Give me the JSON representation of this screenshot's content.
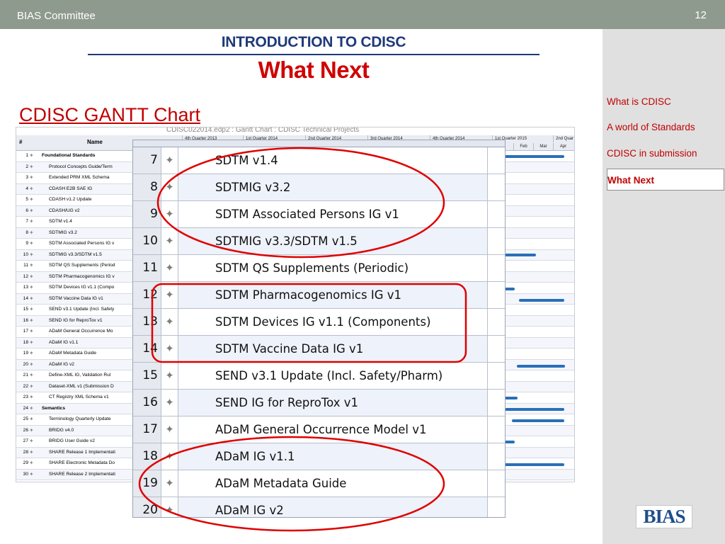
{
  "header": {
    "org": "BIAS Committee",
    "page_number": "12"
  },
  "slide": {
    "section_title": "INTRODUCTION TO CDISC",
    "title": "What Next",
    "chart_title": "CDISC GANTT Chart"
  },
  "sidebar": {
    "items": [
      {
        "label": "What is CDISC",
        "active": false
      },
      {
        "label": "A world of Standards",
        "active": false
      },
      {
        "label": "CDISC in submission",
        "active": false
      },
      {
        "label": "What Next",
        "active": true
      }
    ]
  },
  "gantt_background": {
    "caption": "CDISC022014.edp2 : Gantt Chart : CDISC Technical Projects",
    "header": {
      "hash": "#",
      "name": "Name"
    },
    "quarters": [
      "4th Quarter 2013",
      "1st Quarter 2014",
      "2nd Quarter 2014",
      "3rd Quarter 2014",
      "4th Quarter 2014",
      "1st Quarter 2015",
      "2nd Quar"
    ],
    "months": [
      "Feb",
      "Mar",
      "Apr"
    ],
    "rows": [
      {
        "n": "1",
        "name": "Foundational Standards",
        "style": "bold"
      },
      {
        "n": "2",
        "name": "Protocol Concepts Guide/Term",
        "style": "indent"
      },
      {
        "n": "3",
        "name": "Extended PRM XML Schema",
        "style": "indent"
      },
      {
        "n": "4",
        "name": "CDASH E2B SAE IG",
        "style": "indent"
      },
      {
        "n": "5",
        "name": "CDASH v1.2 Update",
        "style": "indent"
      },
      {
        "n": "6",
        "name": "CDASH/UG v2",
        "style": "indent"
      },
      {
        "n": "7",
        "name": "SDTM v1.4",
        "style": "indent"
      },
      {
        "n": "8",
        "name": "SDTMIG v3.2",
        "style": "indent"
      },
      {
        "n": "9",
        "name": "SDTM Associated Persons IG v",
        "style": "indent"
      },
      {
        "n": "10",
        "name": "SDTMIG v3.3/SDTM v1.5",
        "style": "indent"
      },
      {
        "n": "11",
        "name": "SDTM QS Supplements (Period",
        "style": "indent"
      },
      {
        "n": "12",
        "name": "SDTM Pharmacogenomics IG v",
        "style": "indent"
      },
      {
        "n": "13",
        "name": "SDTM Devices IG v1.1 (Compo",
        "style": "indent"
      },
      {
        "n": "14",
        "name": "SDTM Vaccine Data IG v1",
        "style": "indent"
      },
      {
        "n": "15",
        "name": "SEND v3.1 Update (Incl. Safety",
        "style": "indent"
      },
      {
        "n": "16",
        "name": "SEND IG for ReproTox v1",
        "style": "indent"
      },
      {
        "n": "17",
        "name": "ADaM General Occurrence Mo",
        "style": "indent"
      },
      {
        "n": "18",
        "name": "ADaM IG v1.1",
        "style": "indent"
      },
      {
        "n": "19",
        "name": "ADaM Metadata Guide",
        "style": "indent"
      },
      {
        "n": "20",
        "name": "ADaM IG v2",
        "style": "indent"
      },
      {
        "n": "21",
        "name": "Define-XML IG, Validation Rul",
        "style": "indent"
      },
      {
        "n": "22",
        "name": "Dataset-XML v1 (Submission D",
        "style": "indent"
      },
      {
        "n": "23",
        "name": "CT Registry XML Schema v1",
        "style": "indent"
      },
      {
        "n": "24",
        "name": "Semantics",
        "style": "bold"
      },
      {
        "n": "25",
        "name": "Terminology Quarterly Update",
        "style": "indent"
      },
      {
        "n": "26",
        "name": "BRIDG v4.0",
        "style": "indent"
      },
      {
        "n": "27",
        "name": "BRIDG User Guide v2",
        "style": "indent"
      },
      {
        "n": "28",
        "name": "SHARE Release 1 Implementati",
        "style": "indent"
      },
      {
        "n": "29",
        "name": "SHARE Electronic Metadata Do",
        "style": "indent"
      },
      {
        "n": "30",
        "name": "SHARE Release 2 Implementati",
        "style": "indent"
      }
    ]
  },
  "zoom_table": {
    "rows": [
      {
        "n": "7",
        "task": "SDTM v1.4"
      },
      {
        "n": "8",
        "task": "SDTMIG v3.2"
      },
      {
        "n": "9",
        "task": "SDTM Associated Persons IG v1"
      },
      {
        "n": "10",
        "task": "SDTMIG v3.3/SDTM v1.5"
      },
      {
        "n": "11",
        "task": "SDTM QS Supplements (Periodic)"
      },
      {
        "n": "12",
        "task": "SDTM Pharmacogenomics IG v1"
      },
      {
        "n": "13",
        "task": "SDTM Devices IG v1.1 (Components)"
      },
      {
        "n": "14",
        "task": "SDTM Vaccine Data IG v1"
      },
      {
        "n": "15",
        "task": "SEND v3.1 Update (Incl. Safety/Pharm)"
      },
      {
        "n": "16",
        "task": "SEND IG for ReproTox v1"
      },
      {
        "n": "17",
        "task": "ADaM General Occurrence Model v1"
      },
      {
        "n": "18",
        "task": "ADaM IG v1.1"
      },
      {
        "n": "19",
        "task": "ADaM Metadata Guide"
      },
      {
        "n": "20",
        "task": "ADaM IG v2"
      }
    ]
  },
  "logo": {
    "text": "BIAS"
  },
  "colors": {
    "accent_red": "#c00000",
    "title_blue": "#1f3a7a",
    "topbar": "#8e9a8e",
    "sidebar": "#e0e0e0",
    "bar_blue": "#2a6fb8"
  }
}
